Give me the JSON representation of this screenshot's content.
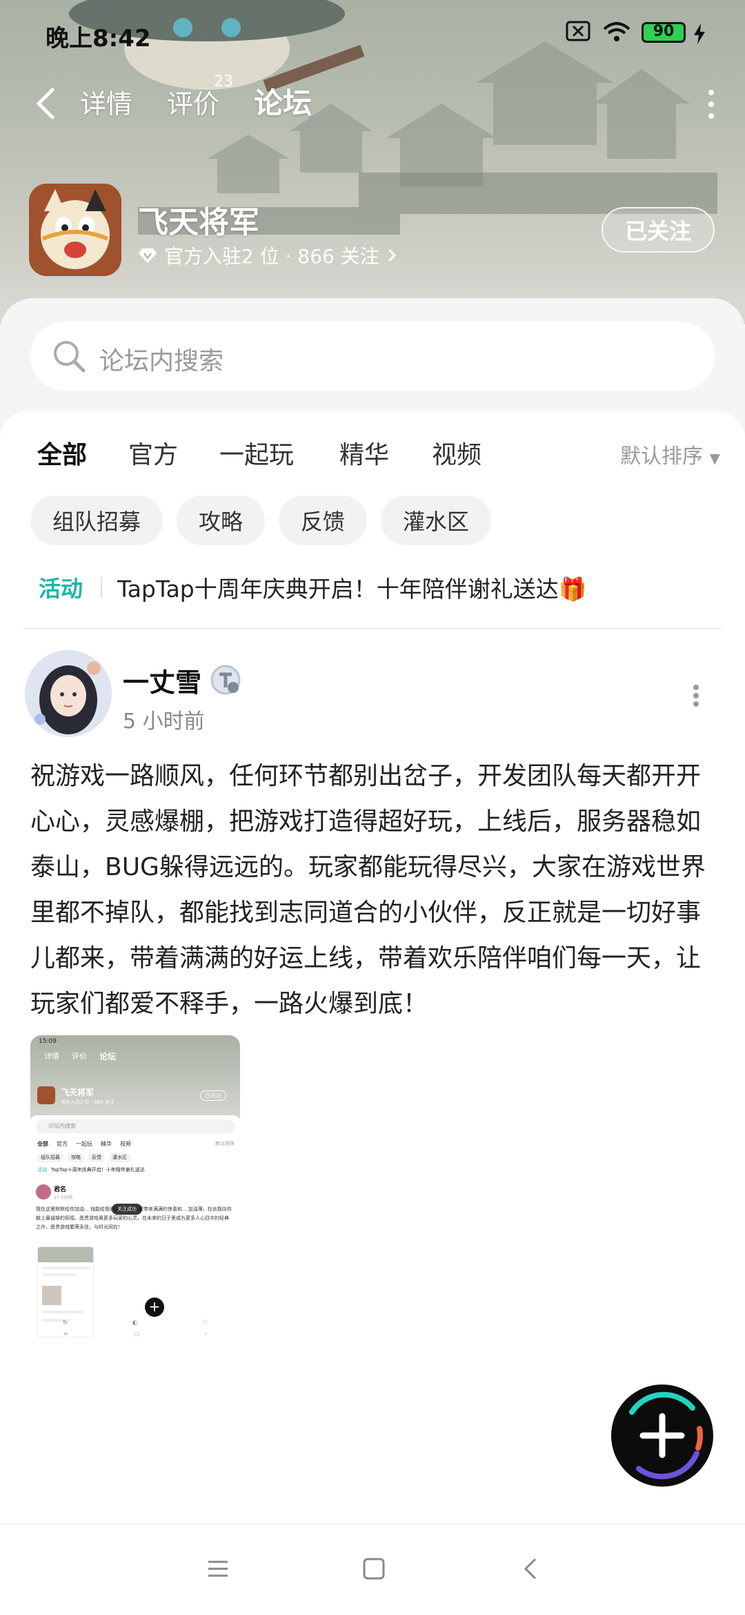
{
  "status_bar": {
    "time": "晚上8:42",
    "battery": "90"
  },
  "header": {
    "tabs": [
      {
        "label": "详情"
      },
      {
        "label": "评价",
        "superscript": "23"
      },
      {
        "label": "论坛"
      }
    ],
    "active_tab": "论坛"
  },
  "game": {
    "name": "飞天将军",
    "meta": "官方入驻2 位 · 866 关注",
    "follow_label": "已关注"
  },
  "search": {
    "placeholder": "论坛内搜索"
  },
  "filter_tabs": [
    {
      "label": "全部"
    },
    {
      "label": "官方"
    },
    {
      "label": "一起玩"
    },
    {
      "label": "精华"
    },
    {
      "label": "视频"
    }
  ],
  "sort_label": "默认排序",
  "chips": [
    {
      "label": "组队招募"
    },
    {
      "label": "攻略"
    },
    {
      "label": "反馈"
    },
    {
      "label": "灌水区"
    }
  ],
  "activity": {
    "tag": "活动",
    "text": "TapTap十周年庆典开启！十年陪伴谢礼送达🎁"
  },
  "post": {
    "author": "一丈雪",
    "time": "5 小时前",
    "content": "祝游戏一路顺风，任何环节都别出岔子，开发团队每天都开开心心，灵感爆棚，把游戏打造得超好玩，上线后，服务器稳如泰山，BUG躲得远远的。玩家都能玩得尽兴，大家在游戏世界里都不掉队，都能找到志同道合的小伙伴，反正就是一切好事儿都来，带着满满的好运上线，带着欢乐陪伴咱们每一天，让玩家们都爱不释手，一路火爆到底！"
  },
  "thumbnail": {
    "time": "15:09",
    "tabs": [
      "详情",
      "评价",
      "论坛"
    ],
    "game_name": "飞天将军",
    "meta": "官方入驻2 位 · 866 关注",
    "follow_label": "已关注",
    "search_placeholder": "论坛内搜索",
    "filter_tabs": [
      "全部",
      "官方",
      "一起玩",
      "精华",
      "视频"
    ],
    "sort_label": "默认排序",
    "chips": [
      "组队招募",
      "攻略",
      "反馈",
      "灌水区"
    ],
    "activity_tag": "活动",
    "activity_text": "TapTap十周年庆典开启！十年陪伴谢礼送达",
    "author": "君名",
    "time_ago": "17 小时前",
    "content": "我在这里默默给你加油... 戏能给我们这些忠实玩家带来满满的惊喜和... 加油薄，在此我向你献上最诚挚的祝福，愿贵游戏奥更多玩家的心灵，在未来的日子里成为更多人心目中的经典之作，愿贵游戏繁荣永驻，与时光同在！",
    "toast": "关注成功"
  },
  "colors": {
    "accent": "#16d2c2",
    "activity": "#16b8a8",
    "fab": "#0c0c0c"
  }
}
